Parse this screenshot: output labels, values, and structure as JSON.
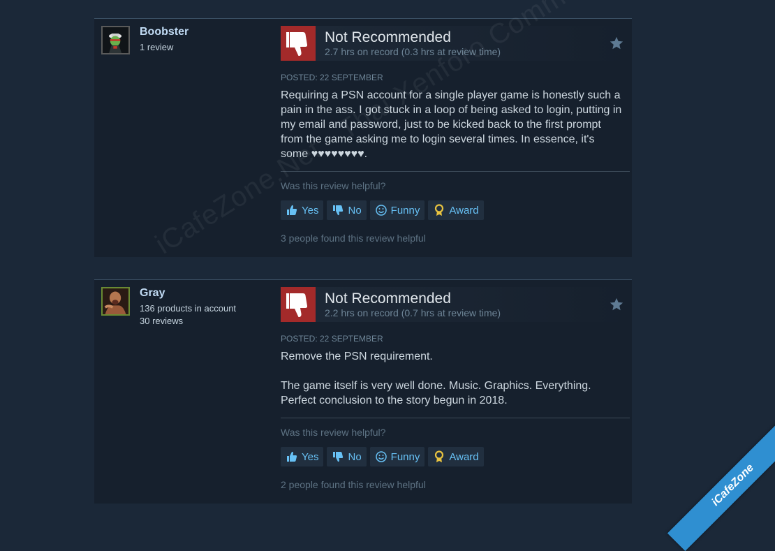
{
  "colors": {
    "background": "#1b2838",
    "panel": "#16202d",
    "negative": "#a32a2a",
    "link": "#67c1f5",
    "award": "#e8c340"
  },
  "reviews": [
    {
      "username": "Boobster",
      "info": [
        "1 review"
      ],
      "verdict": "Not Recommended",
      "hours": "2.7 hrs on record (0.3 hrs at review time)",
      "posted": "POSTED: 22 SEPTEMBER",
      "paragraphs": [
        "Requiring a PSN account for a single player game is honestly such a pain in the ass. I got stuck in a loop of being asked to login, putting in my email and password, just to be kicked back to the first prompt from the game asking me to login several times. In essence, it's some ♥♥♥♥♥♥♥♥."
      ],
      "helpful_question": "Was this review helpful?",
      "buttons": {
        "yes": "Yes",
        "no": "No",
        "funny": "Funny",
        "award": "Award"
      },
      "helpful_count": "3 people found this review helpful"
    },
    {
      "username": "Gray",
      "info": [
        "136 products in account",
        "30 reviews"
      ],
      "verdict": "Not Recommended",
      "hours": "2.2 hrs on record (0.7 hrs at review time)",
      "posted": "POSTED: 22 SEPTEMBER",
      "paragraphs": [
        "Remove the PSN requirement.",
        "The game itself is very well done. Music. Graphics. Everything. Perfect conclusion to the story begun in 2018."
      ],
      "helpful_question": "Was this review helpful?",
      "buttons": {
        "yes": "Yes",
        "no": "No",
        "funny": "Funny",
        "award": "Award"
      },
      "helpful_count": "2 people found this review helpful"
    }
  ],
  "watermark": "iCafeZone.Net - Thai Xenforo Community",
  "ribbon": "iCafeZone"
}
